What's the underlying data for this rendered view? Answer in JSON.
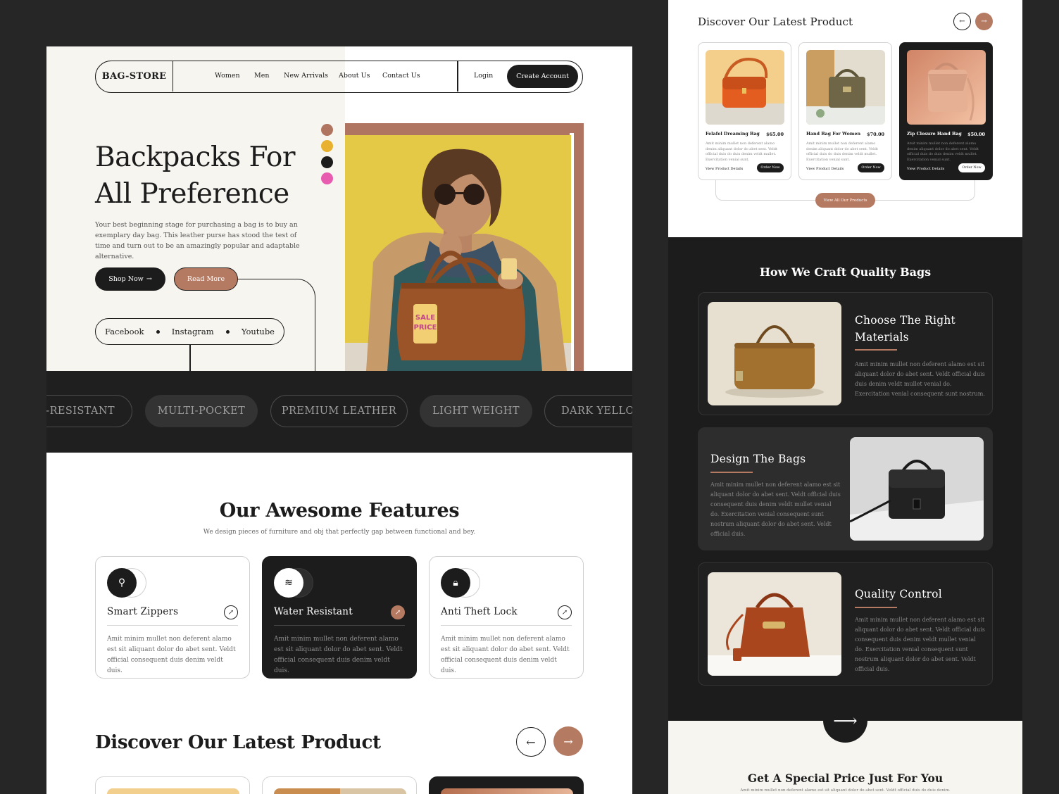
{
  "colors": {
    "accent": "#b57a62",
    "dark": "#1c1c1c",
    "cream": "#f7f5f0",
    "mustard": "#e2c846"
  },
  "nav": {
    "logo": "BAG-STORE",
    "links": [
      "Women",
      "Men",
      "New Arrivals",
      "About Us",
      "Contact Us"
    ],
    "login": "Login",
    "create_account": "Create Account"
  },
  "hero": {
    "title_line1": "Backpacks For",
    "title_line2": "All Preference",
    "description": "Your best beginning stage for purchasing a bag is to buy an exemplary day bag. This leather purse has stood the test of time and turn out to be an amazingly popular and adaptable alternative.",
    "shop_now": "Shop Now",
    "read_more": "Read More",
    "social": [
      "Facebook",
      "Instagram",
      "Youtube"
    ],
    "swatches": [
      "#b07560",
      "#e8b230",
      "#1c1c1c",
      "#e85cb0"
    ],
    "tag_text": "SALE PRICE"
  },
  "tags": [
    "R-RESISTANT",
    "MULTI-POCKET",
    "PREMIUM LEATHER",
    "LIGHT WEIGHT",
    "DARK YELLOW"
  ],
  "features": {
    "title": "Our Awesome Features",
    "subtitle": "We design pieces of furniture and obj that perfectly gap between functional and bey.",
    "items": [
      {
        "title": "Smart Zippers",
        "desc": "Amit minim mullet non deferent alamo est sit aliquant dolor do abet sent. Veldt official consequent duis denim veldt duis.",
        "icon": "zipper-icon"
      },
      {
        "title": "Water Resistant",
        "desc": "Amit minim mullet non deferent alamo est sit aliquant dolor do abet sent. Veldt official consequent duis denim veldt duis.",
        "icon": "water-icon"
      },
      {
        "title": "Anti Theft Lock",
        "desc": "Amit minim mullet non deferent alamo est sit aliquant dolor do abet sent. Veldt official consequent duis denim veldt duis.",
        "icon": "lock-icon"
      }
    ]
  },
  "discover": {
    "title": "Discover Our Latest Product"
  },
  "products": {
    "title": "Discover Our Latest Product",
    "view_details": "View Product Details",
    "order_now": "Order Now",
    "view_all": "View All Our Products",
    "items": [
      {
        "name": "Felafel Dreaming Bag",
        "price": "$65.00",
        "desc": "Amit minim mullet non deferent alamo denim aliquant dolor do abet sent. Veldt official duis do duis denim veldt mullet. Exercitation venial sunt."
      },
      {
        "name": "Hand Bag For Women",
        "price": "$70.00",
        "desc": "Amit minim mullet non deferent alamo denim aliquant dolor do abet sent. Veldt official duis do duis denim veldt mullet. Exercitation venial sunt."
      },
      {
        "name": "Zip Closure Hand Bag",
        "price": "$50.00",
        "desc": "Amit minim mullet non deferent alamo denim aliquant dolor do abet sent. Veldt official duis do duis denim veldt mullet. Exercitation venial sunt."
      }
    ]
  },
  "craft": {
    "title": "How We Craft Quality Bags",
    "steps": [
      {
        "title_l1": "Choose The Right",
        "title_l2": "Materials",
        "desc": "Amit minim mullet non deferent alamo est sit aliquant dolor do abet sent. Veldt official duis duis denim veldt mullet venial do. Exercitation venial consequent sunt nostrum."
      },
      {
        "title_l1": "Design The Bags",
        "title_l2": "",
        "desc": "Amit minim mullet non deferent alamo est sit aliquant dolor do abet sent. Veldt official duis consequent duis denim veldt mullet venial do. Exercitation venial consequent sunt nostrum aliquant dolor do abet sent. Veldt official duis."
      },
      {
        "title_l1": "Quality Control",
        "title_l2": "",
        "desc": "Amit minim mullet non deferent alamo est sit aliquant dolor do abet sent. Veldt official duis consequent duis denim veldt mullet venial do. Exercitation venial consequent sunt nostrum aliquant dolor do abet sent. Veldt official duis."
      }
    ]
  },
  "special": {
    "title": "Get A Special Price Just For You",
    "subtitle": "Amit minim mullet non deferent alamo est sit aliquant dolor do abet sent. Veldt official duis do duis denim."
  }
}
